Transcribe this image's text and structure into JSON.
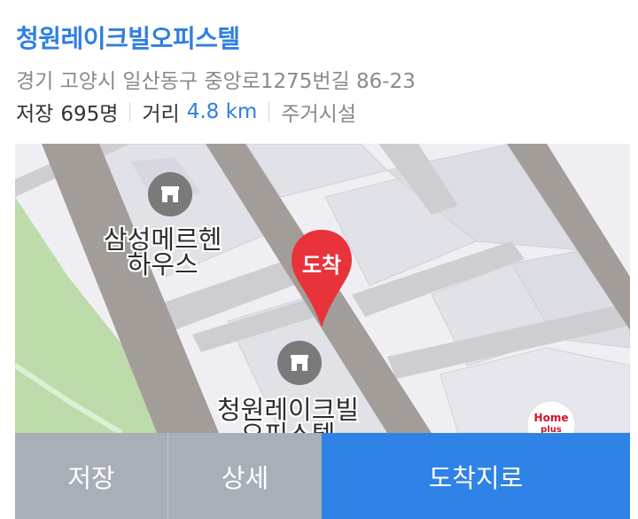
{
  "place": {
    "title": "청원레이크빌오피스텔",
    "address": "경기 고양시 일산동구 중앙로1275번길 86-23",
    "save_label": "저장",
    "save_count": "695명",
    "distance_label": "거리",
    "distance_value": "4.8 km",
    "category": "주거시설"
  },
  "map": {
    "poi_1_line1": "삼성메르헨",
    "poi_1_line2": "하우스",
    "poi_2_line1": "청원레이크빌",
    "poi_2_line2": "오피스텔",
    "pin_label": "도착",
    "brand_line1": "Home",
    "brand_line2": "plus",
    "pin_color": "#e8333b",
    "poi_icon": "building-icon"
  },
  "actions": {
    "save": "저장",
    "detail": "상세",
    "arrive": "도착지로"
  },
  "colors": {
    "accent": "#3083e6",
    "title_blue": "#2f7fe0",
    "button_gray": "#a8afb8"
  }
}
